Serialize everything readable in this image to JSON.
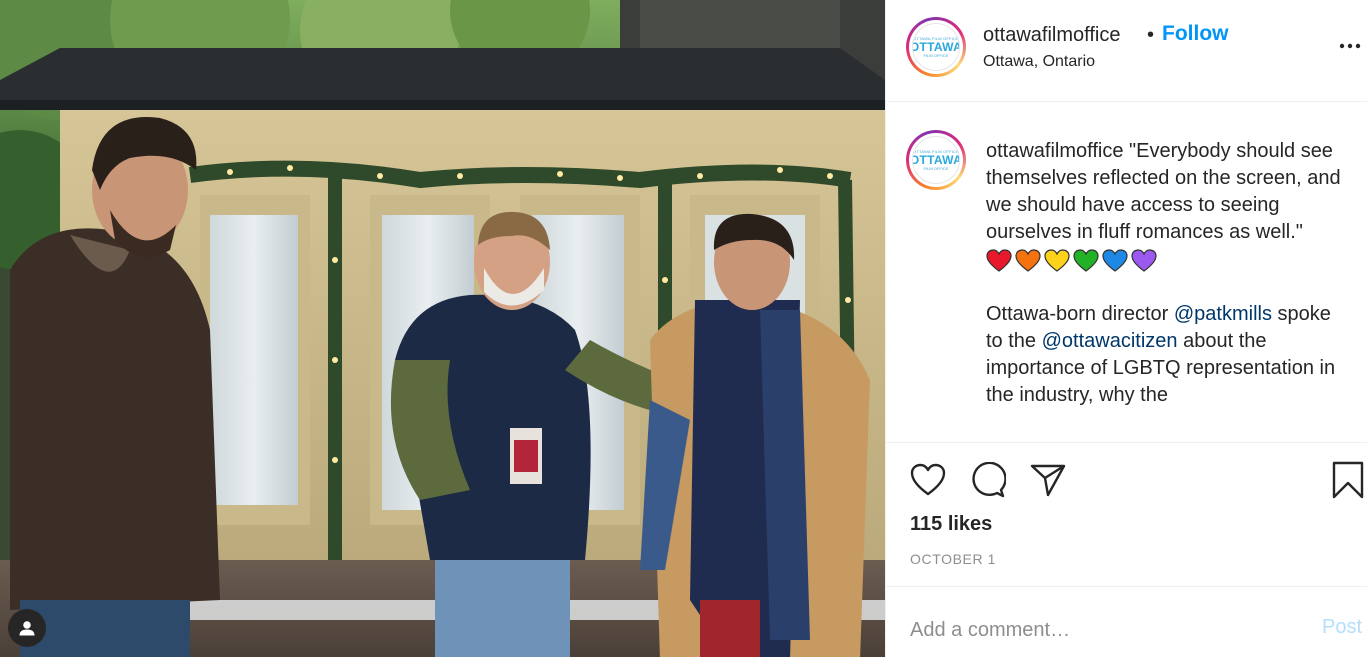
{
  "post": {
    "username": "ottawafilmoffice",
    "separator": "•",
    "follow_label": "Follow",
    "location": "Ottawa, Ontario",
    "logo": {
      "top_text": "OTTAWA FILM OFFICE",
      "main_text": "OTTAWA",
      "sub_text": "FILM OFFICE"
    },
    "caption": {
      "quote": "\"Everybody should see themselves reflected on the screen, and we should have access to seeing ourselves in fluff romances as well.\"",
      "hearts": [
        {
          "name": "red-heart-icon",
          "color": "#e8182d"
        },
        {
          "name": "orange-heart-icon",
          "color": "#f4730f"
        },
        {
          "name": "yellow-heart-icon",
          "color": "#fcd21a"
        },
        {
          "name": "green-heart-icon",
          "color": "#23b226"
        },
        {
          "name": "blue-heart-icon",
          "color": "#1e88e5"
        },
        {
          "name": "purple-heart-icon",
          "color": "#9b59f0"
        }
      ],
      "p2_prefix": "Ottawa-born director ",
      "mention1": "@patkmills",
      "p2_mid": " spoke to the ",
      "mention2": "@ottawacitizen",
      "p2_suffix": " about the importance of LGBTQ representation in the industry, why the"
    },
    "likes": "115 likes",
    "date": "OCTOBER 1",
    "comment_placeholder": "Add a comment…",
    "post_label": "Post",
    "icons": {
      "like": "heart-outline-icon",
      "comment": "comment-bubble-icon",
      "share": "paper-plane-icon",
      "save": "bookmark-icon",
      "more": "more-horizontal-icon",
      "tagged": "tagged-user-icon"
    },
    "colors": {
      "accent": "#0095f6",
      "mention": "#00376b",
      "muted": "#8e8e8e"
    }
  }
}
